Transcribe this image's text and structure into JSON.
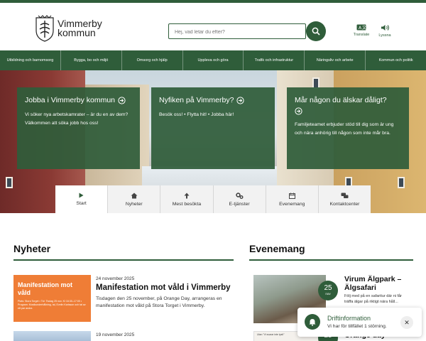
{
  "header": {
    "logo_line1": "Vimmerby",
    "logo_line2": "kommun",
    "search_placeholder": "Hej, vad letar du efter?",
    "translate_label": "Translate",
    "listen_label": "Lyssna"
  },
  "nav": {
    "items": [
      "Utbildning och barnomsorg",
      "Bygga, bo och miljö",
      "Omsorg och hjälp",
      "Uppleva och göra",
      "Trafik och infrastruktur",
      "Näringsliv och arbete",
      "Kommun och politik"
    ]
  },
  "hero": {
    "cards": [
      {
        "title": "Jobba i Vimmerby kommun",
        "text": "Vi söker nya arbetskamrater – är du en av dem? Välkommen att söka jobb hos oss!"
      },
      {
        "title": "Nyfiken på Vimmerby?",
        "text": "Besök oss! • Flytta hit! • Jobba här!"
      },
      {
        "title": "Mår någon du älskar dåligt?",
        "text": "Familjeteamet erbjuder stöd till dig som är ung och nära anhörig till någon som inte mår bra."
      }
    ],
    "tabs": [
      "Start",
      "Nyheter",
      "Mest besökta",
      "E-tjänster",
      "Evenemang",
      "Kontaktcenter"
    ]
  },
  "news": {
    "heading": "Nyheter",
    "item1": {
      "image_title": "Manifestation mot våld",
      "image_small": "Plats: Stora Torget • Tid: Tisdag 25 nov. Kl 16:30–17:00 • Program: Musikunderhållning, tal, Evelin Karlsson och tal av ett par andra",
      "date": "24 november 2025",
      "title": "Manifestation mot våld i Vimmerby",
      "excerpt": "Tisdagen den 25 november, på Orange Day, arrangeras en manifestation mot våld på Stora Torget i Vimmerby."
    },
    "item2": {
      "date": "19 november 2025"
    }
  },
  "events": {
    "heading": "Evenemang",
    "item1": {
      "day": "25",
      "month": "nov",
      "title": "Virum Älgpark – Älgsafari",
      "text": "Följ med på en safaritur där ni får träffa älgar på riktigt nära håll..."
    },
    "item2": {
      "day": "25",
      "image_text": "Utan \"Vi svarar inte tyst!\"",
      "title": "Orange day"
    }
  },
  "toast": {
    "title": "Driftinformation",
    "text": "Vi har för tillfället 1 störning.",
    "close": "✕"
  },
  "colors": {
    "brand": "#2f5d3a",
    "news_orange": "#ef7d36"
  }
}
